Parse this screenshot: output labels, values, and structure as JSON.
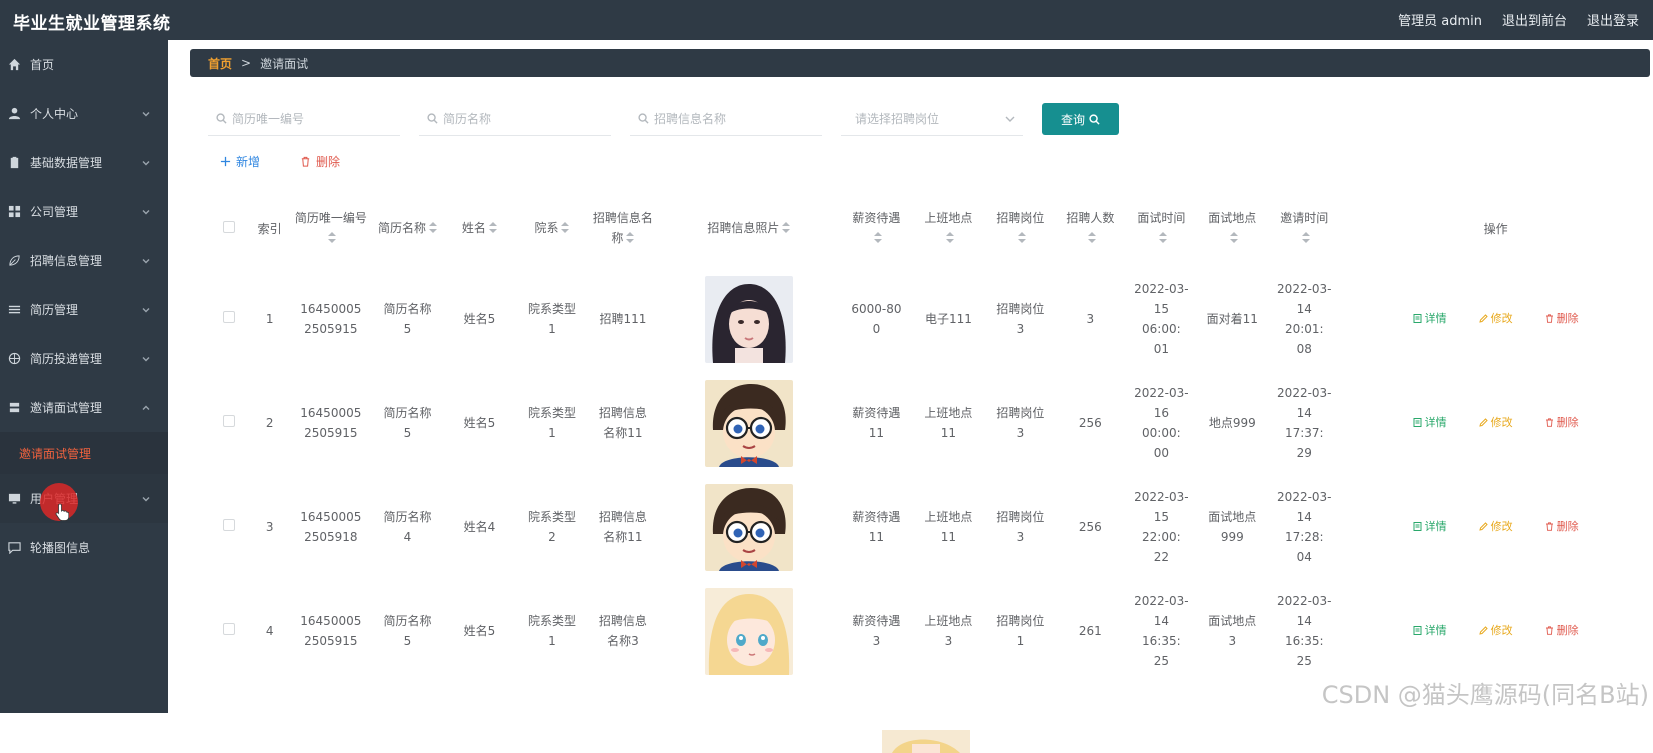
{
  "app": {
    "title": "毕业生就业管理系统",
    "admin_label": "管理员 admin",
    "to_front_label": "退出到前台",
    "logout_label": "退出登录"
  },
  "sidebar": {
    "items": [
      {
        "label": "首页",
        "icon": "home-icon",
        "has_chevron": false
      },
      {
        "label": "个人中心",
        "icon": "user-icon",
        "has_chevron": true
      },
      {
        "label": "基础数据管理",
        "icon": "clipboard-icon",
        "has_chevron": true
      },
      {
        "label": "公司管理",
        "icon": "grid-icon",
        "has_chevron": true
      },
      {
        "label": "招聘信息管理",
        "icon": "leaf-icon",
        "has_chevron": true
      },
      {
        "label": "简历管理",
        "icon": "list-icon",
        "has_chevron": true
      },
      {
        "label": "简历投递管理",
        "icon": "globe-icon",
        "has_chevron": true
      },
      {
        "label": "邀请面试管理",
        "icon": "stack-icon",
        "has_chevron": true,
        "expanded": true
      },
      {
        "label": "用户管理",
        "icon": "monitor-icon",
        "has_chevron": true
      },
      {
        "label": "轮播图信息",
        "icon": "chat-icon",
        "has_chevron": false
      }
    ],
    "sub_item": "邀请面试管理"
  },
  "breadcrumb": {
    "home": "首页",
    "separator": ">",
    "current": "邀请面试"
  },
  "search": {
    "resume_id_placeholder": "简历唯一编号",
    "resume_name_placeholder": "简历名称",
    "job_name_placeholder": "招聘信息名称",
    "position_placeholder": "请选择招聘岗位",
    "query_label": "查询"
  },
  "toolbar": {
    "add_label": "新增",
    "delete_label": "删除"
  },
  "table": {
    "headers": {
      "index": "索引",
      "resume_id": "简历唯一编号",
      "resume_name": "简历名称",
      "name": "姓名",
      "department": "院系",
      "job_name": "招聘信息名称",
      "job_photo": "招聘信息照片",
      "salary": "薪资待遇",
      "location": "上班地点",
      "position": "招聘岗位",
      "headcount": "招聘人数",
      "interview_time": "面试时间",
      "interview_place": "面试地点",
      "invite_time": "邀请时间",
      "operations": "操作"
    },
    "rows": [
      {
        "index": "1",
        "resume_id": "16450005 2505915",
        "resume_name": "简历名称 5",
        "name": "姓名5",
        "department": "院系类型 1",
        "job_name": "招聘111",
        "photo": "girl",
        "salary": "6000-80 0",
        "location": "电子111",
        "position": "招聘岗位 3",
        "headcount": "3",
        "interview_time": "2022-03- 15 06:00: 01",
        "interview_place": "面对着11",
        "invite_time": "2022-03- 14 20:01: 08"
      },
      {
        "index": "2",
        "resume_id": "16450005 2505915",
        "resume_name": "简历名称 5",
        "name": "姓名5",
        "department": "院系类型 1",
        "job_name": "招聘信息 名称11",
        "photo": "conan",
        "salary": "薪资待遇 11",
        "location": "上班地点 11",
        "position": "招聘岗位 3",
        "headcount": "256",
        "interview_time": "2022-03- 16 00:00: 00",
        "interview_place": "地点999",
        "invite_time": "2022-03- 14 17:37: 29"
      },
      {
        "index": "3",
        "resume_id": "16450005 2505918",
        "resume_name": "简历名称 4",
        "name": "姓名4",
        "department": "院系类型 2",
        "job_name": "招聘信息 名称11",
        "photo": "conan",
        "salary": "薪资待遇 11",
        "location": "上班地点 11",
        "position": "招聘岗位 3",
        "headcount": "256",
        "interview_time": "2022-03- 15 22:00: 22",
        "interview_place": "面试地点 999",
        "invite_time": "2022-03- 14 17:28: 04"
      },
      {
        "index": "4",
        "resume_id": "16450005 2505915",
        "resume_name": "简历名称 5",
        "name": "姓名5",
        "department": "院系类型 1",
        "job_name": "招聘信息 名称3",
        "photo": "anime",
        "salary": "薪资待遇 3",
        "location": "上班地点 3",
        "position": "招聘岗位 1",
        "headcount": "261",
        "interview_time": "2022-03- 14 16:35: 25",
        "interview_place": "面试地点 3",
        "invite_time": "2022-03- 14 16:35: 25"
      }
    ],
    "op_labels": {
      "detail": "详情",
      "edit": "修改",
      "delete": "删除"
    }
  },
  "colors": {
    "sidebar_bg": "#2f3a45",
    "accent_teal": "#168f90",
    "active_sub": "#f0623e",
    "detail_green": "#2aa86b",
    "edit_orange": "#e8a91e",
    "delete_red": "#e05a4e"
  },
  "watermark": "CSDN @猫头鹰源码(同名B站)"
}
